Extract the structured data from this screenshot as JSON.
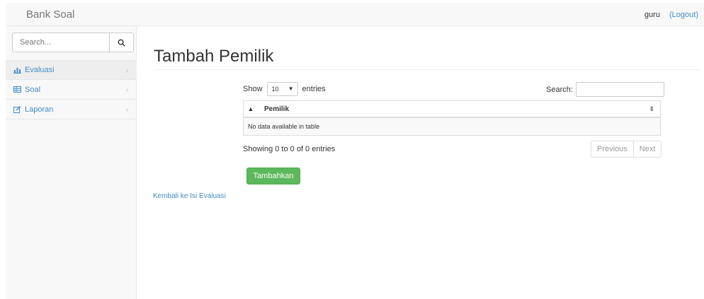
{
  "navbar": {
    "brand": "Bank Soal",
    "user": "guru",
    "logout": "(Logout)"
  },
  "sidebar": {
    "search_placeholder": "Search...",
    "items": [
      {
        "label": "Evaluasi",
        "icon": "bar-chart-icon"
      },
      {
        "label": "Soal",
        "icon": "table-icon"
      },
      {
        "label": "Laporan",
        "icon": "edit-icon"
      }
    ]
  },
  "content": {
    "title": "Tambah Pemilik",
    "show_label": "Show",
    "entries_value": "10",
    "entries_label": "entries",
    "search_label": "Search:",
    "table": {
      "column": "Pemilik",
      "empty_text": "No data available in table"
    },
    "info": "Showing 0 to 0 of 0 entries",
    "pager": {
      "previous": "Previous",
      "next": "Next"
    },
    "add_button": "Tambahkan",
    "back_link": "Kembali ke Isi Evaluasi"
  },
  "colors": {
    "link": "#428bca",
    "success": "#5cb85c",
    "sidebar_bg": "#f8f8f8"
  }
}
